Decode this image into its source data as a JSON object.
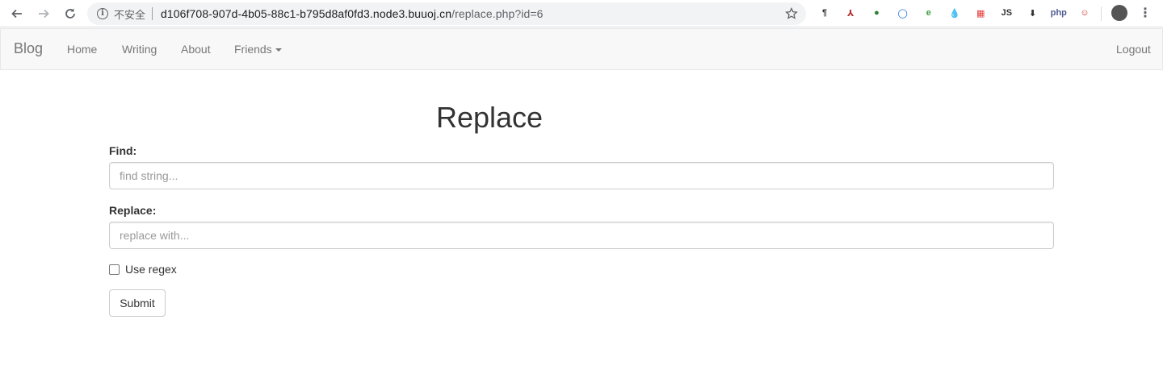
{
  "browser": {
    "security_label": "不安全",
    "url_host": "d106f708-907d-4b05-88c1-b795d8af0fd3.node3.buuoj.cn",
    "url_path": "/replace.php?id=6",
    "extensions": [
      {
        "icon": "pilcrow-extension-icon",
        "glyph": "¶",
        "color": "#333333"
      },
      {
        "icon": "pdf-extension-icon",
        "glyph": "⅄",
        "color": "#b03030"
      },
      {
        "icon": "green-globe-extension-icon",
        "glyph": "●",
        "color": "#2e7d32"
      },
      {
        "icon": "ring-extension-icon",
        "glyph": "◯",
        "color": "#1e6fd9"
      },
      {
        "icon": "e-extension-icon",
        "glyph": "e",
        "color": "#43a047"
      },
      {
        "icon": "drop-extension-icon",
        "glyph": "💧",
        "color": "#1565c0"
      },
      {
        "icon": "flag-extension-icon",
        "glyph": "▦",
        "color": "#e53935"
      },
      {
        "icon": "js-extension-icon",
        "glyph": "JS",
        "color": "#333333"
      },
      {
        "icon": "download-extension-icon",
        "glyph": "⬇",
        "color": "#333333"
      },
      {
        "icon": "php-extension-icon",
        "glyph": "php",
        "color": "#4f5b93"
      },
      {
        "icon": "santa-extension-icon",
        "glyph": "☺",
        "color": "#d32f2f"
      }
    ]
  },
  "navbar": {
    "brand": "Blog",
    "links": [
      "Home",
      "Writing",
      "About",
      "Friends"
    ],
    "logout": "Logout"
  },
  "page": {
    "title": "Replace",
    "find_label": "Find:",
    "find_placeholder": "find string...",
    "replace_label": "Replace:",
    "replace_placeholder": "replace with...",
    "regex_label": "Use regex",
    "regex_checked": false,
    "submit_label": "Submit"
  }
}
